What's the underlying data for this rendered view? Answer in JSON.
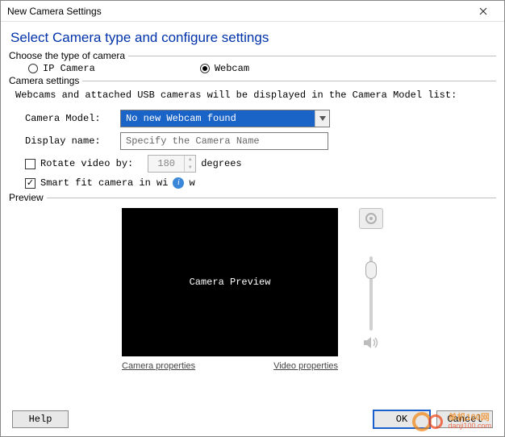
{
  "window": {
    "title": "New Camera Settings"
  },
  "heading": "Select Camera type and configure settings",
  "groups": {
    "cameraType": {
      "legend": "Choose the type of camera",
      "options": {
        "ip": "IP Camera",
        "webcam": "Webcam"
      }
    },
    "cameraSettings": {
      "legend": "Camera settings",
      "hint": "Webcams and attached USB cameras will be displayed in the Camera Model list:",
      "modelLabel": "Camera Model:",
      "modelValue": "No new Webcam found",
      "nameLabel": "Display name:",
      "namePlaceholder": "Specify the Camera Name",
      "rotateLabel": "Rotate video by:",
      "rotateValue": "180",
      "rotateUnits": "degrees",
      "smartFitPrefix": "Smart fit camera in wi",
      "smartFitSuffix": "w"
    },
    "preview": {
      "legend": "Preview",
      "boxText": "Camera Preview",
      "linkCamera": "Camera properties",
      "linkVideo": "Video properties"
    }
  },
  "buttons": {
    "help": "Help",
    "ok": "OK",
    "cancel": "Cancel"
  },
  "watermark": {
    "line1": "单机100网",
    "line2": "danji100.com"
  }
}
